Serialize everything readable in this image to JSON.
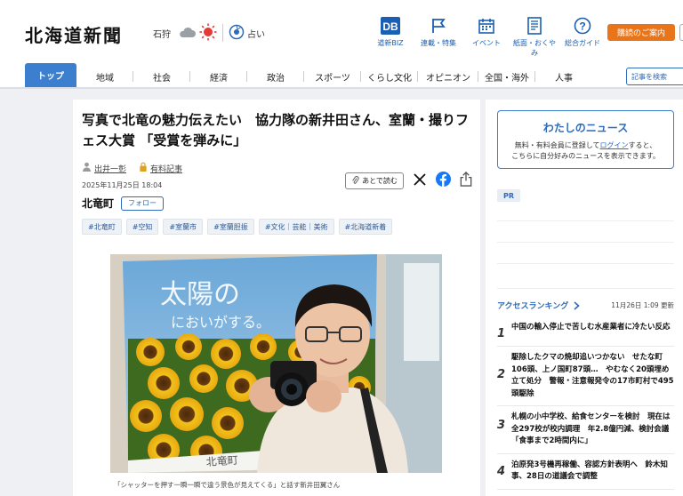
{
  "header": {
    "logo": "北海道新聞",
    "weather": {
      "location": "石狩",
      "fortune": "占い"
    },
    "nav_icons": [
      {
        "label": "道新BIZ",
        "icon": "db-logo-icon"
      },
      {
        "label": "連載・特集",
        "icon": "flag-icon"
      },
      {
        "label": "イベント",
        "icon": "calendar-icon"
      },
      {
        "label": "紙面・おくやみ",
        "icon": "newspaper-icon"
      },
      {
        "label": "総合ガイド",
        "icon": "question-icon"
      }
    ],
    "subscribe_label": "購読のご案内"
  },
  "nav": {
    "tabs": [
      "トップ",
      "地域",
      "社会",
      "経済",
      "政治",
      "スポーツ",
      "くらし文化",
      "オピニオン",
      "全国・海外",
      "人事"
    ],
    "search_label": "記事を検索"
  },
  "article": {
    "headline": "写真で北竜の魅力伝えたい　協力隊の新井田さん、室蘭・撮りフェス大賞 「受賞を弾みに」",
    "author": "出井一彰",
    "paid_label": "有料記事",
    "date": "2025年11月25日 18:04",
    "read_later": "あとで読む",
    "region": "北竜町",
    "follow_label": "フォロー",
    "tags": [
      "#北竜町",
      "#空知",
      "#室蘭市",
      "#室蘭胆振",
      "#文化｜芸能｜美術",
      "#北海道新着"
    ],
    "photo_text": {
      "line1": "太陽の",
      "line2": "においがする。",
      "sign": "北竜町"
    },
    "caption": "「シャッターを押す一瞬一瞬で違う景色が見えてくる」と話す新井田翼さん"
  },
  "sidebar": {
    "mynews_title": "わたしのニュース",
    "mynews_pre": "無料・有料会員に登録して",
    "mynews_link": "ログイン",
    "mynews_post": "すると、",
    "mynews_line2": "こちらに自分好みのニュースを表示できます。",
    "pr_label": "PR",
    "ranking_title": "アクセスランキング",
    "ranking_time": "11月26日 1:09 更新",
    "ranking": [
      {
        "num": "1",
        "text": "中国の輸入停止で苦しむ水産業者に冷たい反応"
      },
      {
        "num": "2",
        "text": "駆除したクマの焼却追いつかない　せたな町106頭、上ノ国町87頭…　やむなく20頭埋め立て処分　警報・注意報発令の17市町村で495頭駆除"
      },
      {
        "num": "3",
        "text": "札幌の小中学校、給食センターを検討　現在は全297校が校内調理　年2.8億円減、検討会議「食事まで2時間内に」"
      },
      {
        "num": "4",
        "text": "泊原発3号機再稼働、容認方針表明へ　鈴木知事、28日の道議会で調整"
      }
    ]
  },
  "colors": {
    "accent": "#3c7fcf",
    "subscribe": "#e8751a",
    "link": "#2e6bb8"
  }
}
